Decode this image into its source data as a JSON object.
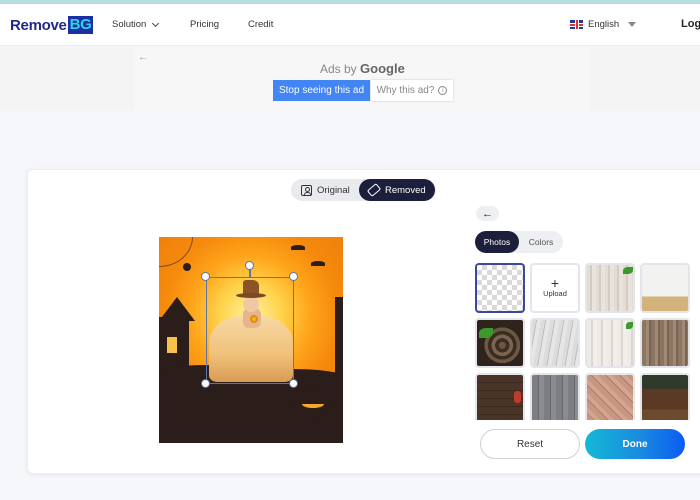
{
  "header": {
    "logo": {
      "part1": "Remove",
      "part2": "BG"
    },
    "nav": [
      {
        "label": "Solution",
        "has_dropdown": true
      },
      {
        "label": "Pricing",
        "has_dropdown": false
      },
      {
        "label": "Credit",
        "has_dropdown": false
      }
    ],
    "language": {
      "label": "English",
      "flag": "uk-flag-icon"
    },
    "login_label": "Log"
  },
  "ad": {
    "back_icon": "←",
    "ads_by_prefix": "Ads by",
    "ads_by_brand": "Google",
    "stop_label": "Stop seeing this ad",
    "why_label": "Why this ad?",
    "info_glyph": "i"
  },
  "editor": {
    "view_toggle": {
      "options": [
        {
          "label": "Original",
          "icon": "portrait-icon",
          "active": false
        },
        {
          "label": "Removed",
          "icon": "eraser-icon",
          "active": true
        }
      ]
    },
    "canvas": {
      "description": "Halloween themed background with girl in witch hat and tulle dress",
      "selection_active": true
    }
  },
  "panel": {
    "back_icon": "←",
    "tabs": [
      {
        "label": "Photos",
        "active": true
      },
      {
        "label": "Colors",
        "active": false
      }
    ],
    "backgrounds": [
      {
        "name": "transparent",
        "selected": true
      },
      {
        "name": "upload",
        "label": "Upload",
        "icon": "+"
      },
      {
        "name": "light-wood-with-plant"
      },
      {
        "name": "white-wall-wood-floor"
      },
      {
        "name": "tree-stump-with-leaf"
      },
      {
        "name": "grey-white-wood"
      },
      {
        "name": "whitewashed-wood-with-plant"
      },
      {
        "name": "brown-wood"
      },
      {
        "name": "dark-wood-with-berries"
      },
      {
        "name": "grey-planks"
      },
      {
        "name": "pink-diagonal-planks"
      },
      {
        "name": "forest-cabin"
      }
    ],
    "reset_label": "Reset",
    "done_label": "Done"
  },
  "colors": {
    "brand_navy": "#1f2a8a",
    "brand_cyan": "#2fd3e0",
    "dark_pill": "#1c1f3b",
    "google_blue": "#4285f4",
    "done_gradient_start": "#14b8d6",
    "done_gradient_end": "#0a5cf2",
    "selection": "#5a75a8"
  }
}
